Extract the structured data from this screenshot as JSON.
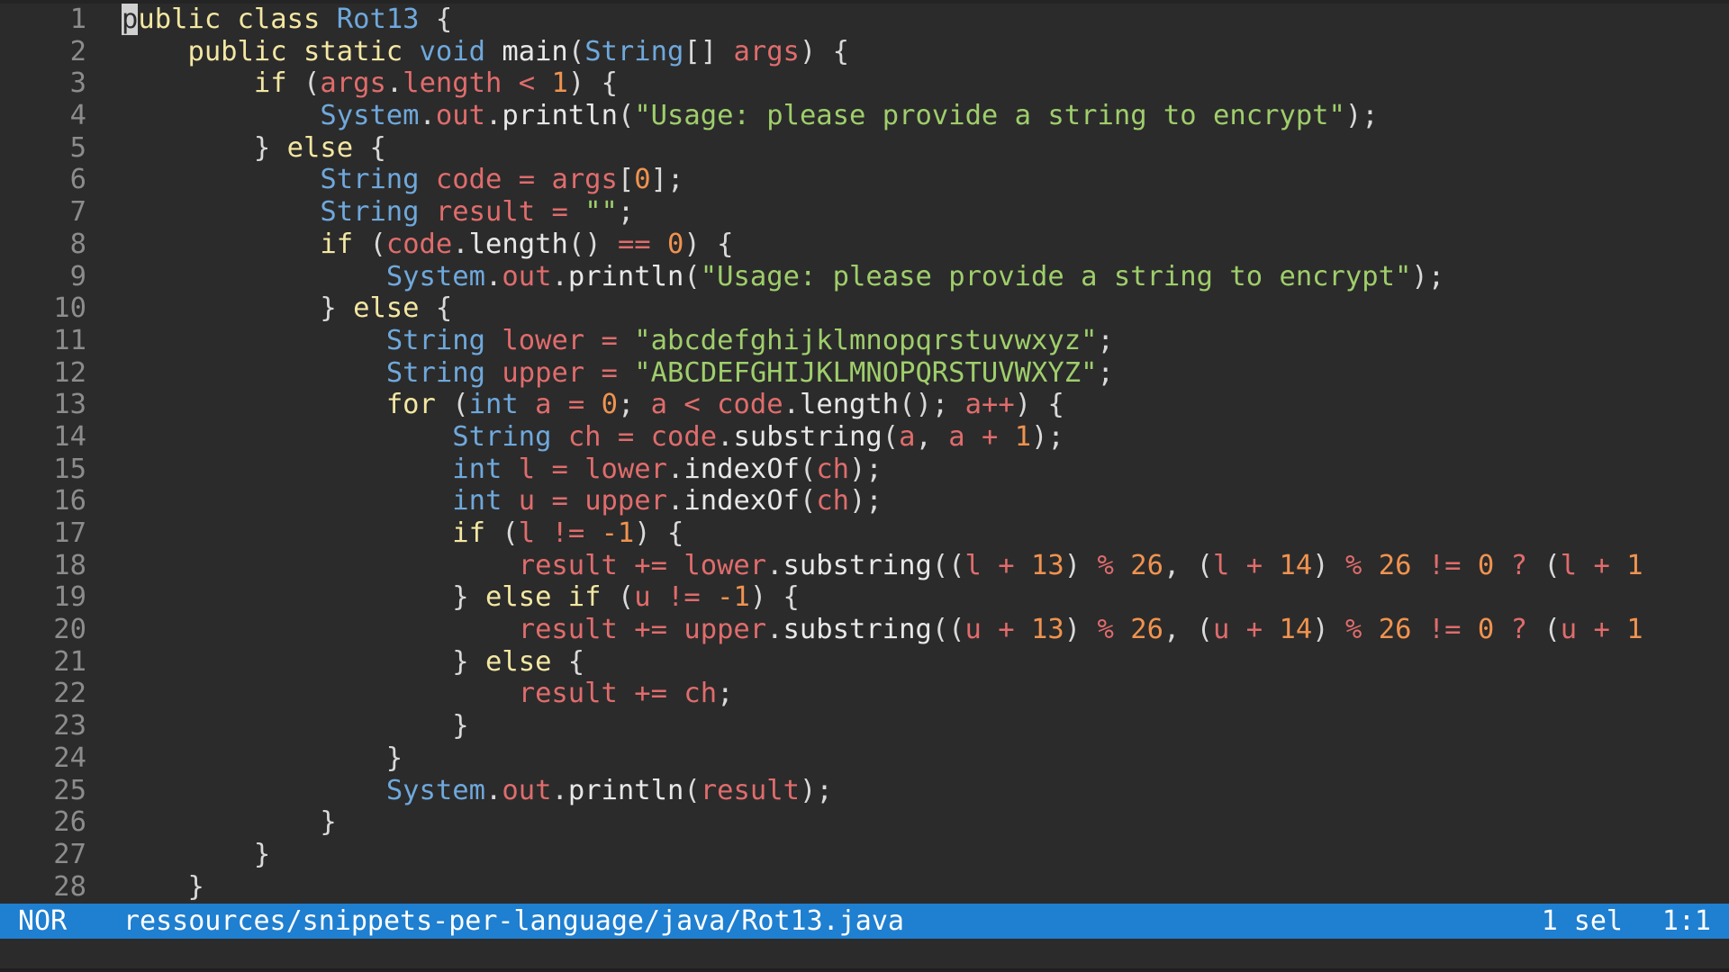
{
  "editor": {
    "lines": [
      {
        "n": "1",
        "tokens": [
          [
            "cursor",
            "p"
          ],
          [
            "kw",
            "ublic class "
          ],
          [
            "ty",
            "Rot13"
          ],
          [
            "pu",
            " {"
          ]
        ]
      },
      {
        "n": "2",
        "tokens": [
          [
            "pu",
            "    "
          ],
          [
            "kw",
            "public static "
          ],
          [
            "ty",
            "void"
          ],
          [
            "fn",
            " main"
          ],
          [
            "pu",
            "("
          ],
          [
            "ty",
            "String"
          ],
          [
            "pu",
            "[] "
          ],
          [
            "va",
            "args"
          ],
          [
            "pu",
            ") {"
          ]
        ]
      },
      {
        "n": "3",
        "tokens": [
          [
            "pu",
            "        "
          ],
          [
            "kw",
            "if"
          ],
          [
            "pu",
            " ("
          ],
          [
            "va",
            "args"
          ],
          [
            "pu",
            "."
          ],
          [
            "va",
            "length"
          ],
          [
            "op",
            " < "
          ],
          [
            "nu",
            "1"
          ],
          [
            "pu",
            ") {"
          ]
        ]
      },
      {
        "n": "4",
        "tokens": [
          [
            "pu",
            "            "
          ],
          [
            "ty",
            "System"
          ],
          [
            "pu",
            "."
          ],
          [
            "va",
            "out"
          ],
          [
            "pu",
            "."
          ],
          [
            "fn",
            "println"
          ],
          [
            "pu",
            "("
          ],
          [
            "st",
            "\"Usage: please provide a string to encrypt\""
          ],
          [
            "pu",
            ");"
          ]
        ]
      },
      {
        "n": "5",
        "tokens": [
          [
            "pu",
            "        } "
          ],
          [
            "kw",
            "else"
          ],
          [
            "pu",
            " {"
          ]
        ]
      },
      {
        "n": "6",
        "tokens": [
          [
            "pu",
            "            "
          ],
          [
            "ty",
            "String "
          ],
          [
            "va",
            "code"
          ],
          [
            "op",
            " = "
          ],
          [
            "va",
            "args"
          ],
          [
            "pu",
            "["
          ],
          [
            "nu",
            "0"
          ],
          [
            "pu",
            "];"
          ]
        ]
      },
      {
        "n": "7",
        "tokens": [
          [
            "pu",
            "            "
          ],
          [
            "ty",
            "String "
          ],
          [
            "va",
            "result"
          ],
          [
            "op",
            " = "
          ],
          [
            "st",
            "\"\""
          ],
          [
            "pu",
            ";"
          ]
        ]
      },
      {
        "n": "8",
        "tokens": [
          [
            "pu",
            "            "
          ],
          [
            "kw",
            "if"
          ],
          [
            "pu",
            " ("
          ],
          [
            "va",
            "code"
          ],
          [
            "pu",
            "."
          ],
          [
            "fn",
            "length"
          ],
          [
            "pu",
            "()"
          ],
          [
            "op",
            " == "
          ],
          [
            "nu",
            "0"
          ],
          [
            "pu",
            ") {"
          ]
        ]
      },
      {
        "n": "9",
        "tokens": [
          [
            "pu",
            "                "
          ],
          [
            "ty",
            "System"
          ],
          [
            "pu",
            "."
          ],
          [
            "va",
            "out"
          ],
          [
            "pu",
            "."
          ],
          [
            "fn",
            "println"
          ],
          [
            "pu",
            "("
          ],
          [
            "st",
            "\"Usage: please provide a string to encrypt\""
          ],
          [
            "pu",
            ");"
          ]
        ]
      },
      {
        "n": "10",
        "tokens": [
          [
            "pu",
            "            } "
          ],
          [
            "kw",
            "else"
          ],
          [
            "pu",
            " {"
          ]
        ]
      },
      {
        "n": "11",
        "tokens": [
          [
            "pu",
            "                "
          ],
          [
            "ty",
            "String "
          ],
          [
            "va",
            "lower"
          ],
          [
            "op",
            " = "
          ],
          [
            "st",
            "\"abcdefghijklmnopqrstuvwxyz\""
          ],
          [
            "pu",
            ";"
          ]
        ]
      },
      {
        "n": "12",
        "tokens": [
          [
            "pu",
            "                "
          ],
          [
            "ty",
            "String "
          ],
          [
            "va",
            "upper"
          ],
          [
            "op",
            " = "
          ],
          [
            "st",
            "\"ABCDEFGHIJKLMNOPQRSTUVWXYZ\""
          ],
          [
            "pu",
            ";"
          ]
        ]
      },
      {
        "n": "13",
        "tokens": [
          [
            "pu",
            "                "
          ],
          [
            "kw",
            "for"
          ],
          [
            "pu",
            " ("
          ],
          [
            "ty",
            "int "
          ],
          [
            "va",
            "a"
          ],
          [
            "op",
            " = "
          ],
          [
            "nu",
            "0"
          ],
          [
            "pu",
            "; "
          ],
          [
            "va",
            "a"
          ],
          [
            "op",
            " < "
          ],
          [
            "va",
            "code"
          ],
          [
            "pu",
            "."
          ],
          [
            "fn",
            "length"
          ],
          [
            "pu",
            "(); "
          ],
          [
            "va",
            "a"
          ],
          [
            "op",
            "++"
          ],
          [
            "pu",
            ") {"
          ]
        ]
      },
      {
        "n": "14",
        "tokens": [
          [
            "pu",
            "                    "
          ],
          [
            "ty",
            "String "
          ],
          [
            "va",
            "ch"
          ],
          [
            "op",
            " = "
          ],
          [
            "va",
            "code"
          ],
          [
            "pu",
            "."
          ],
          [
            "fn",
            "substring"
          ],
          [
            "pu",
            "("
          ],
          [
            "va",
            "a"
          ],
          [
            "pu",
            ", "
          ],
          [
            "va",
            "a"
          ],
          [
            "op",
            " + "
          ],
          [
            "nu",
            "1"
          ],
          [
            "pu",
            ");"
          ]
        ]
      },
      {
        "n": "15",
        "tokens": [
          [
            "pu",
            "                    "
          ],
          [
            "ty",
            "int "
          ],
          [
            "va",
            "l"
          ],
          [
            "op",
            " = "
          ],
          [
            "va",
            "lower"
          ],
          [
            "pu",
            "."
          ],
          [
            "fn",
            "indexOf"
          ],
          [
            "pu",
            "("
          ],
          [
            "va",
            "ch"
          ],
          [
            "pu",
            ");"
          ]
        ]
      },
      {
        "n": "16",
        "tokens": [
          [
            "pu",
            "                    "
          ],
          [
            "ty",
            "int "
          ],
          [
            "va",
            "u"
          ],
          [
            "op",
            " = "
          ],
          [
            "va",
            "upper"
          ],
          [
            "pu",
            "."
          ],
          [
            "fn",
            "indexOf"
          ],
          [
            "pu",
            "("
          ],
          [
            "va",
            "ch"
          ],
          [
            "pu",
            ");"
          ]
        ]
      },
      {
        "n": "17",
        "tokens": [
          [
            "pu",
            "                    "
          ],
          [
            "kw",
            "if"
          ],
          [
            "pu",
            " ("
          ],
          [
            "va",
            "l"
          ],
          [
            "op",
            " != "
          ],
          [
            "nu",
            "-1"
          ],
          [
            "pu",
            ") {"
          ]
        ]
      },
      {
        "n": "18",
        "tokens": [
          [
            "pu",
            "                        "
          ],
          [
            "va",
            "result"
          ],
          [
            "op",
            " += "
          ],
          [
            "va",
            "lower"
          ],
          [
            "pu",
            "."
          ],
          [
            "fn",
            "substring"
          ],
          [
            "pu",
            "(("
          ],
          [
            "va",
            "l"
          ],
          [
            "op",
            " + "
          ],
          [
            "nu",
            "13"
          ],
          [
            "pu",
            ")"
          ],
          [
            "op",
            " % "
          ],
          [
            "nu",
            "26"
          ],
          [
            "pu",
            ", ("
          ],
          [
            "va",
            "l"
          ],
          [
            "op",
            " + "
          ],
          [
            "nu",
            "14"
          ],
          [
            "pu",
            ")"
          ],
          [
            "op",
            " % "
          ],
          [
            "nu",
            "26"
          ],
          [
            "op",
            " != "
          ],
          [
            "nu",
            "0"
          ],
          [
            "op",
            " ? "
          ],
          [
            "pu",
            "("
          ],
          [
            "va",
            "l"
          ],
          [
            "op",
            " + "
          ],
          [
            "nu",
            "1"
          ]
        ]
      },
      {
        "n": "19",
        "tokens": [
          [
            "pu",
            "                    } "
          ],
          [
            "kw",
            "else if"
          ],
          [
            "pu",
            " ("
          ],
          [
            "va",
            "u"
          ],
          [
            "op",
            " != "
          ],
          [
            "nu",
            "-1"
          ],
          [
            "pu",
            ") {"
          ]
        ]
      },
      {
        "n": "20",
        "tokens": [
          [
            "pu",
            "                        "
          ],
          [
            "va",
            "result"
          ],
          [
            "op",
            " += "
          ],
          [
            "va",
            "upper"
          ],
          [
            "pu",
            "."
          ],
          [
            "fn",
            "substring"
          ],
          [
            "pu",
            "(("
          ],
          [
            "va",
            "u"
          ],
          [
            "op",
            " + "
          ],
          [
            "nu",
            "13"
          ],
          [
            "pu",
            ")"
          ],
          [
            "op",
            " % "
          ],
          [
            "nu",
            "26"
          ],
          [
            "pu",
            ", ("
          ],
          [
            "va",
            "u"
          ],
          [
            "op",
            " + "
          ],
          [
            "nu",
            "14"
          ],
          [
            "pu",
            ")"
          ],
          [
            "op",
            " % "
          ],
          [
            "nu",
            "26"
          ],
          [
            "op",
            " != "
          ],
          [
            "nu",
            "0"
          ],
          [
            "op",
            " ? "
          ],
          [
            "pu",
            "("
          ],
          [
            "va",
            "u"
          ],
          [
            "op",
            " + "
          ],
          [
            "nu",
            "1"
          ]
        ]
      },
      {
        "n": "21",
        "tokens": [
          [
            "pu",
            "                    } "
          ],
          [
            "kw",
            "else"
          ],
          [
            "pu",
            " {"
          ]
        ]
      },
      {
        "n": "22",
        "tokens": [
          [
            "pu",
            "                        "
          ],
          [
            "va",
            "result"
          ],
          [
            "op",
            " += "
          ],
          [
            "va",
            "ch"
          ],
          [
            "pu",
            ";"
          ]
        ]
      },
      {
        "n": "23",
        "tokens": [
          [
            "pu",
            "                    }"
          ]
        ]
      },
      {
        "n": "24",
        "tokens": [
          [
            "pu",
            "                }"
          ]
        ]
      },
      {
        "n": "25",
        "tokens": [
          [
            "pu",
            "                "
          ],
          [
            "ty",
            "System"
          ],
          [
            "pu",
            "."
          ],
          [
            "va",
            "out"
          ],
          [
            "pu",
            "."
          ],
          [
            "fn",
            "println"
          ],
          [
            "pu",
            "("
          ],
          [
            "va",
            "result"
          ],
          [
            "pu",
            ");"
          ]
        ]
      },
      {
        "n": "26",
        "tokens": [
          [
            "pu",
            "            }"
          ]
        ]
      },
      {
        "n": "27",
        "tokens": [
          [
            "pu",
            "        }"
          ]
        ]
      },
      {
        "n": "28",
        "tokens": [
          [
            "pu",
            "    }"
          ]
        ]
      }
    ]
  },
  "statusbar": {
    "mode": "NOR",
    "file_path": "ressources/snippets-per-language/java/Rot13.java",
    "selections": "1 sel",
    "position": "1:1"
  },
  "colors": {
    "background": "#2b2b2b",
    "statusbar": "#1f7fd0",
    "keyword": "#f3e7a2",
    "type": "#6fa8dc",
    "variable": "#e06c6c",
    "string": "#9fce6b",
    "number": "#f0934f",
    "line_number": "#8c8c8c"
  }
}
